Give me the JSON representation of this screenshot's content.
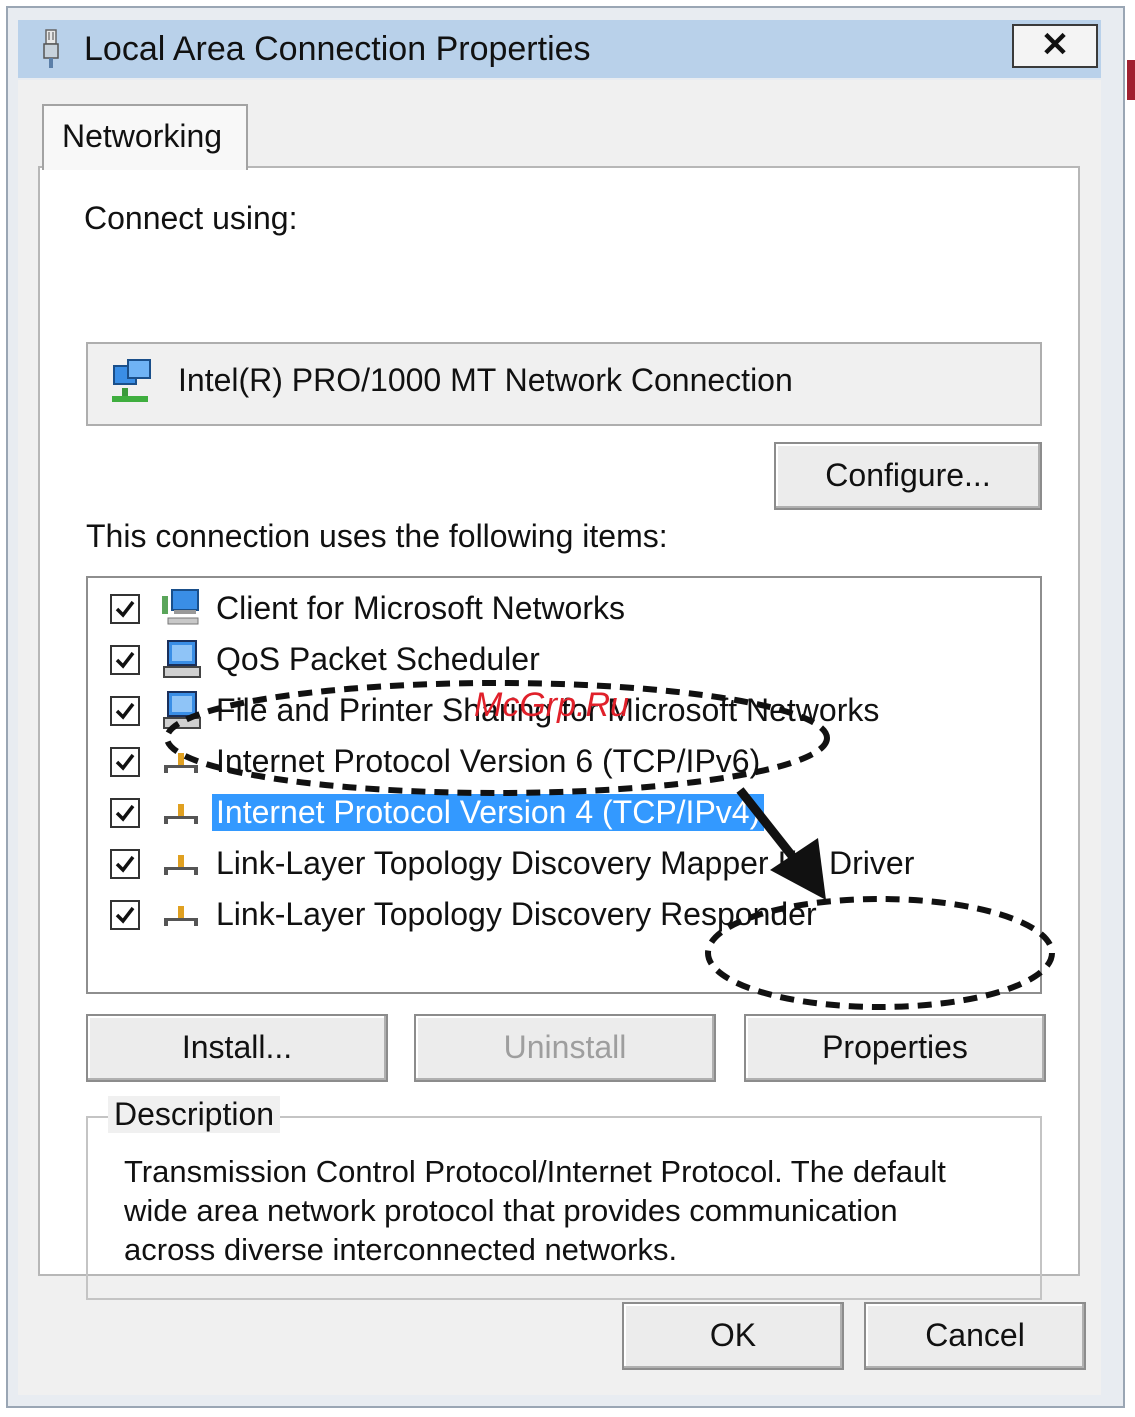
{
  "window": {
    "title": "Local Area Connection Properties",
    "close_glyph": "✕"
  },
  "tabs": [
    {
      "label": "Networking",
      "active": true
    }
  ],
  "connect_using": {
    "label": "Connect using:",
    "adapter_name": "Intel(R) PRO/1000 MT Network Connection",
    "adapter_icon": "network-adapter-icon",
    "configure_label": "Configure..."
  },
  "items_section": {
    "label": "This connection uses the following items:",
    "items": [
      {
        "label": "Client for Microsoft Networks",
        "checked": true,
        "icon": "client-network-icon",
        "selected": false
      },
      {
        "label": "QoS Packet Scheduler",
        "checked": true,
        "icon": "computer-icon",
        "selected": false
      },
      {
        "label": "File and Printer Sharing for Microsoft Networks",
        "checked": true,
        "icon": "computer-icon",
        "selected": false
      },
      {
        "label": "Internet Protocol Version 6 (TCP/IPv6)",
        "checked": true,
        "icon": "protocol-icon",
        "selected": false
      },
      {
        "label": "Internet Protocol Version 4 (TCP/IPv4)",
        "checked": true,
        "icon": "protocol-icon",
        "selected": true
      },
      {
        "label": "Link-Layer Topology Discovery Mapper I/O Driver",
        "checked": true,
        "icon": "protocol-icon",
        "selected": false
      },
      {
        "label": "Link-Layer Topology Discovery Responder",
        "checked": true,
        "icon": "protocol-icon",
        "selected": false
      }
    ]
  },
  "item_buttons": {
    "install": "Install...",
    "uninstall": "Uninstall",
    "properties": "Properties"
  },
  "description": {
    "legend": "Description",
    "lines": [
      "Transmission Control Protocol/Internet Protocol. The default",
      "wide area network protocol that provides communication",
      "across diverse interconnected networks."
    ]
  },
  "footer": {
    "ok": "OK",
    "cancel": "Cancel"
  },
  "watermark": "McGrp.Ru",
  "colors": {
    "titlebar": "#b9d1ea",
    "selection": "#3399ff",
    "watermark": "#e0202a"
  }
}
